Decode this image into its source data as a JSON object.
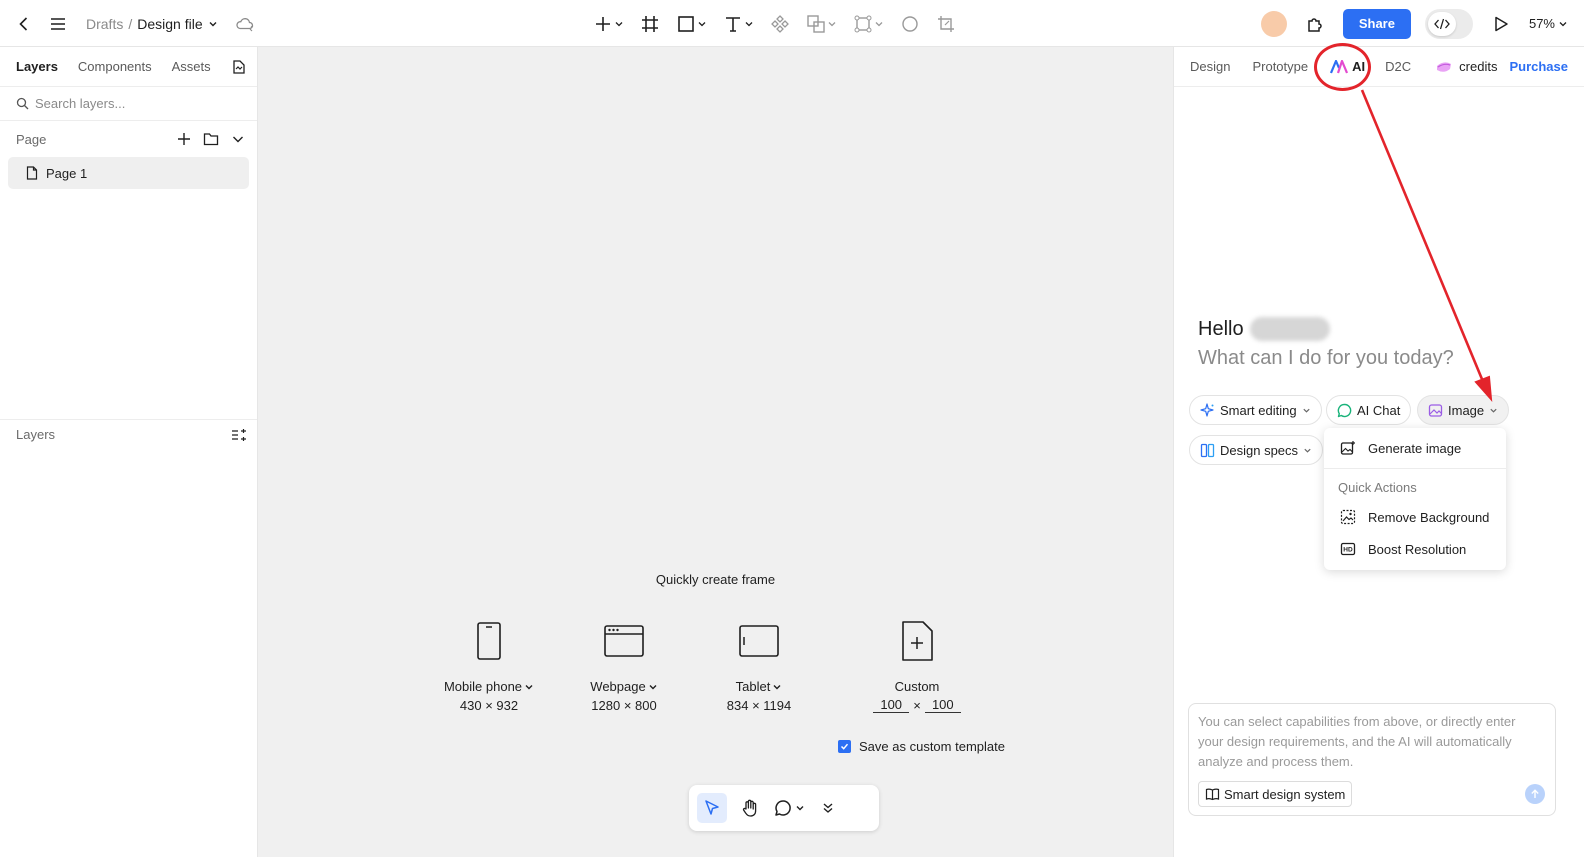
{
  "topbar": {
    "breadcrumb_parent": "Drafts",
    "breadcrumb_sep": "/",
    "file_name": "Design file",
    "share_label": "Share",
    "zoom": "57%"
  },
  "left_panel": {
    "tabs": [
      "Layers",
      "Components",
      "Assets"
    ],
    "search_placeholder": "Search layers...",
    "page_section": "Page",
    "pages": [
      "Page 1"
    ],
    "layers_section": "Layers"
  },
  "canvas": {
    "quick_title": "Quickly create frame",
    "presets": [
      {
        "name": "Mobile phone",
        "size": "430 × 932"
      },
      {
        "name": "Webpage",
        "size": "1280 × 800"
      },
      {
        "name": "Tablet",
        "size": "834 × 1194"
      }
    ],
    "custom": {
      "name": "Custom",
      "width": "100",
      "times": "×",
      "height": "100"
    },
    "save_template": "Save as custom template"
  },
  "right_panel": {
    "tabs": {
      "design": "Design",
      "prototype": "Prototype",
      "ai": "AI",
      "d2c": "D2C"
    },
    "credits": "credits",
    "purchase": "Purchase",
    "hello": "Hello",
    "subtitle": "What can I do for you today?",
    "chips": {
      "smart_editing": "Smart editing",
      "ai_chat": "AI Chat",
      "image": "Image",
      "design_specs": "Design specs"
    },
    "dropdown": {
      "generate": "Generate image",
      "quick_actions": "Quick Actions",
      "remove_bg": "Remove Background",
      "boost": "Boost Resolution"
    },
    "composer_placeholder": "You can select capabilities from above, or directly enter your design requirements, and the AI will automatically analyze and process them.",
    "smart_design_system": "Smart design system"
  },
  "colors": {
    "accent": "#2c6ff3",
    "annotation": "#e3242b"
  }
}
